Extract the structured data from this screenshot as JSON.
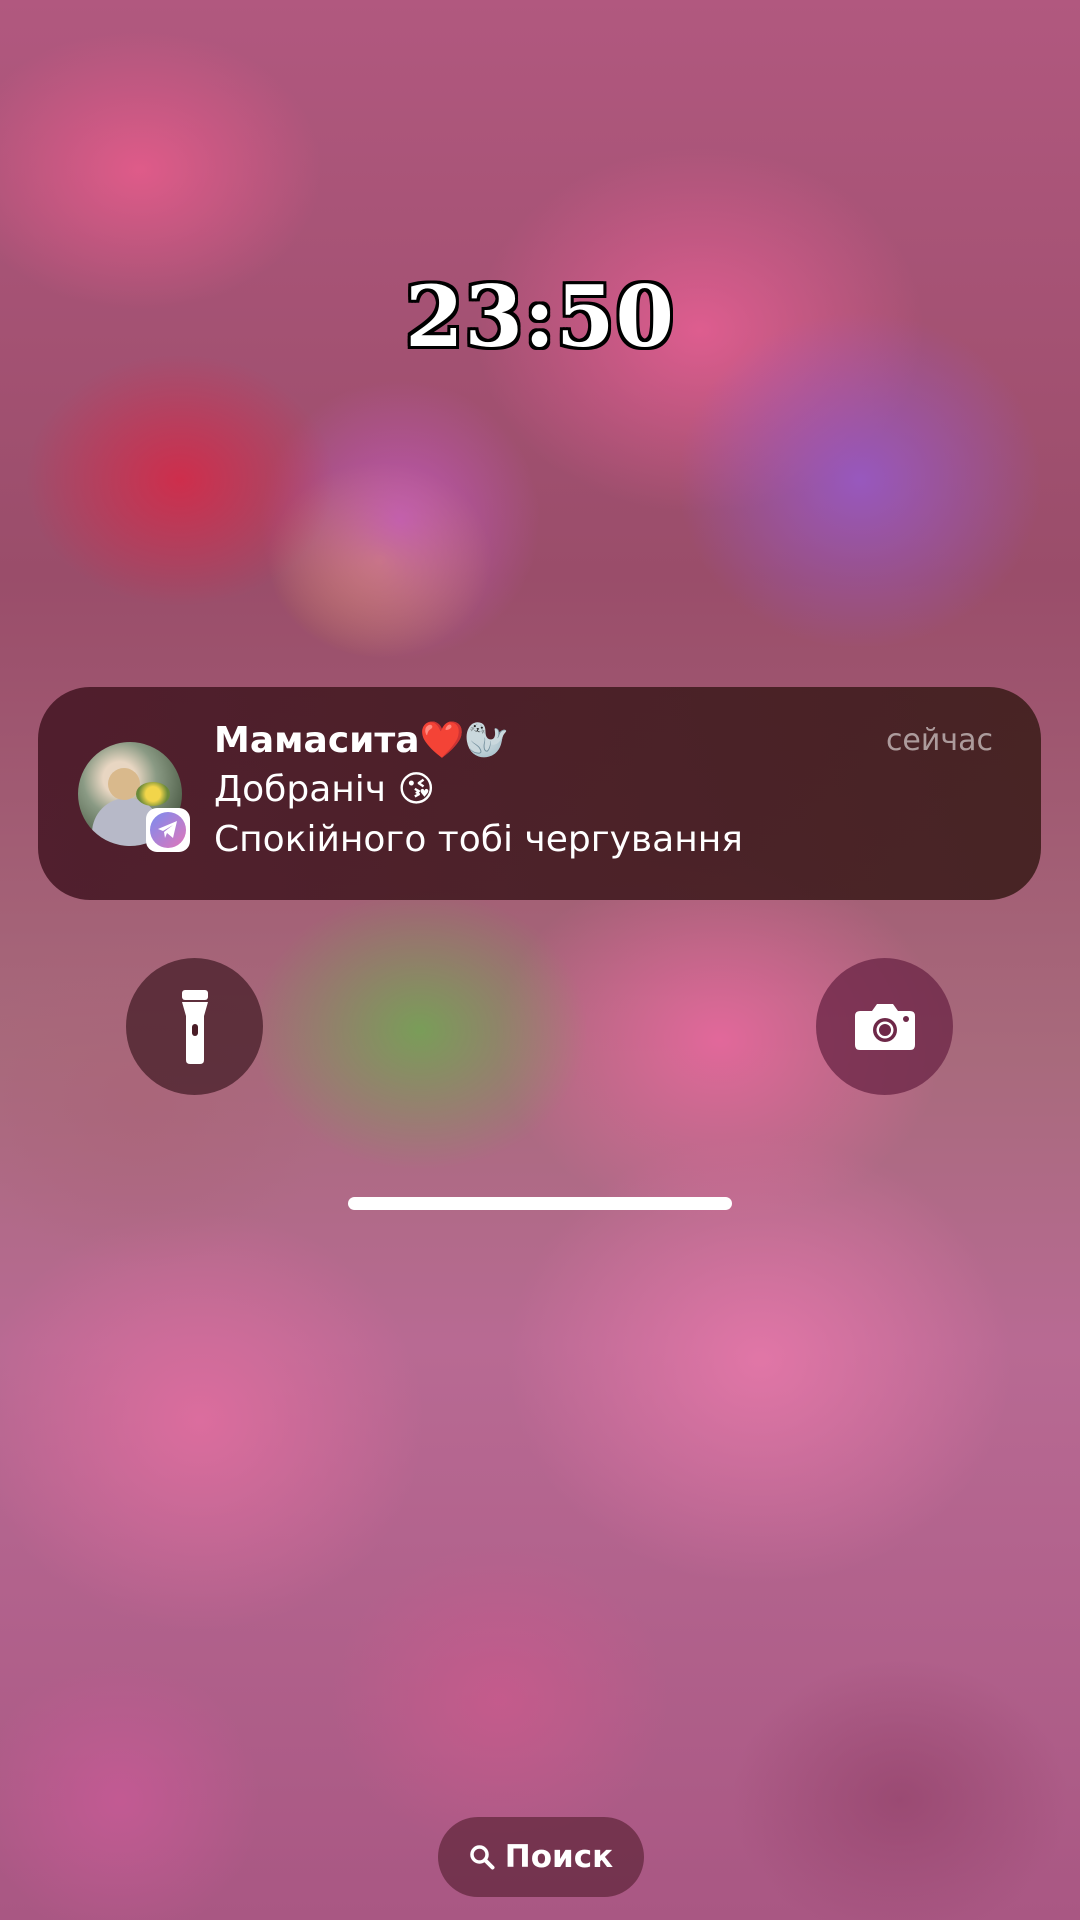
{
  "lock_screen": {
    "time": "23:50"
  },
  "notification": {
    "app": "telegram",
    "app_icon": "telegram-icon",
    "sender": "Мамасита❤️🦭",
    "timestamp": "сейчас",
    "lines": [
      "Добраніч 😘",
      "Спокійного тобі чергування"
    ]
  },
  "quick_actions": {
    "left_icon": "flashlight-icon",
    "right_icon": "camera-icon"
  },
  "search": {
    "label": "Поиск",
    "icon": "search-icon"
  },
  "colors": {
    "notification_bg": "#4a1c26",
    "flash_button_bg": "#461e28",
    "camera_button_bg": "#6e2848",
    "search_pill_bg": "#5f263a"
  }
}
